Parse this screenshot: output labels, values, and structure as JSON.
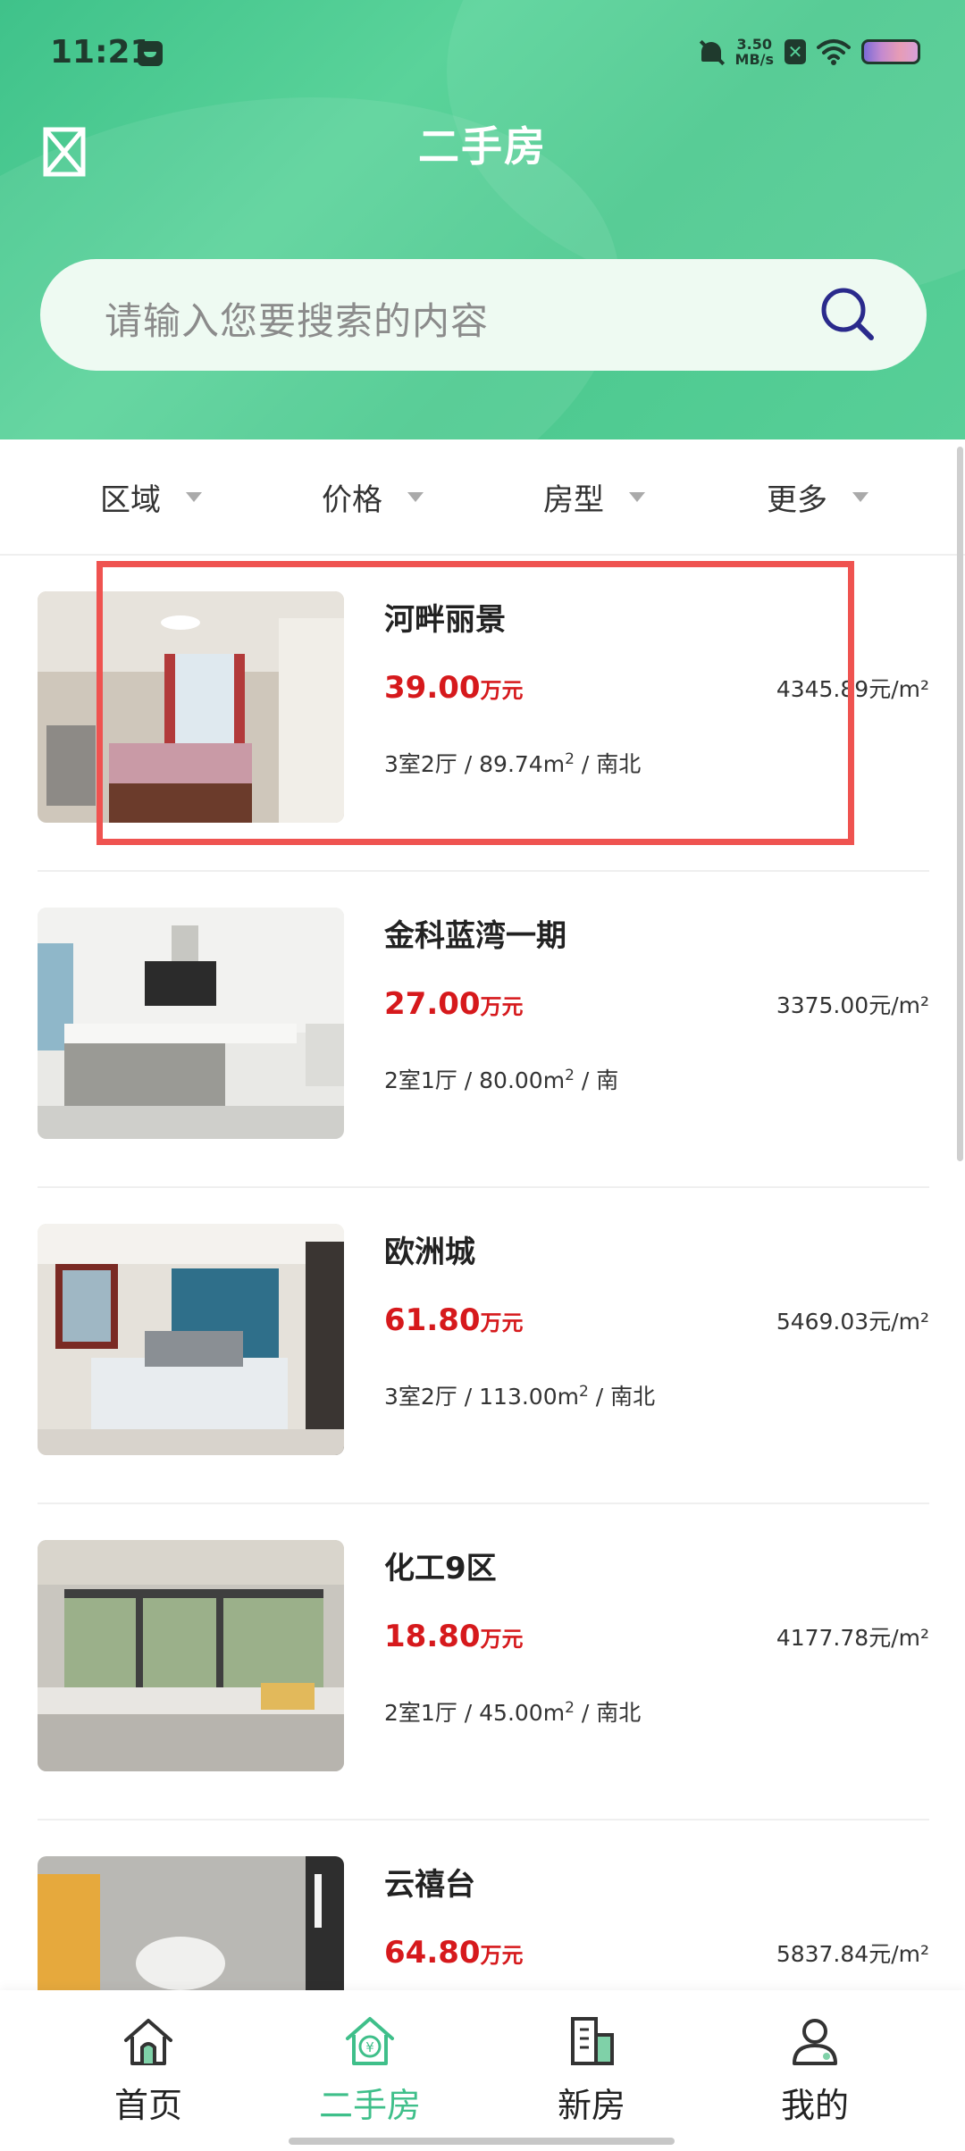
{
  "status_bar": {
    "time": "11:21",
    "net_speed_value": "3.50",
    "net_speed_unit": "MB/s"
  },
  "header": {
    "title": "二手房"
  },
  "search": {
    "placeholder": "请输入您要搜索的内容"
  },
  "filters": [
    {
      "label": "区域"
    },
    {
      "label": "价格"
    },
    {
      "label": "房型"
    },
    {
      "label": "更多"
    }
  ],
  "listings": [
    {
      "name": "河畔丽景",
      "price": "39.00",
      "price_unit": "万元",
      "unit_price": "4345.89元/m²",
      "layout": "3室2厅",
      "area": "89.74m",
      "orientation": "南北"
    },
    {
      "name": "金科蓝湾一期",
      "price": "27.00",
      "price_unit": "万元",
      "unit_price": "3375.00元/m²",
      "layout": "2室1厅",
      "area": "80.00m",
      "orientation": "南"
    },
    {
      "name": "欧洲城",
      "price": "61.80",
      "price_unit": "万元",
      "unit_price": "5469.03元/m²",
      "layout": "3室2厅",
      "area": "113.00m",
      "orientation": "南北"
    },
    {
      "name": "化工9区",
      "price": "18.80",
      "price_unit": "万元",
      "unit_price": "4177.78元/m²",
      "layout": "2室1厅",
      "area": "45.00m",
      "orientation": "南北"
    },
    {
      "name": "云禧台",
      "price": "64.80",
      "price_unit": "万元",
      "unit_price": "5837.84元/m²",
      "layout": "",
      "area": "",
      "orientation": ""
    }
  ],
  "bottom_nav": [
    {
      "label": "首页",
      "icon": "home-icon"
    },
    {
      "label": "二手房",
      "icon": "resale-house-icon",
      "active": true
    },
    {
      "label": "新房",
      "icon": "new-building-icon"
    },
    {
      "label": "我的",
      "icon": "profile-icon"
    }
  ],
  "colors": {
    "brand_green": "#4cc98f",
    "price_red": "#d6191c",
    "highlight_red": "#ef5350"
  }
}
